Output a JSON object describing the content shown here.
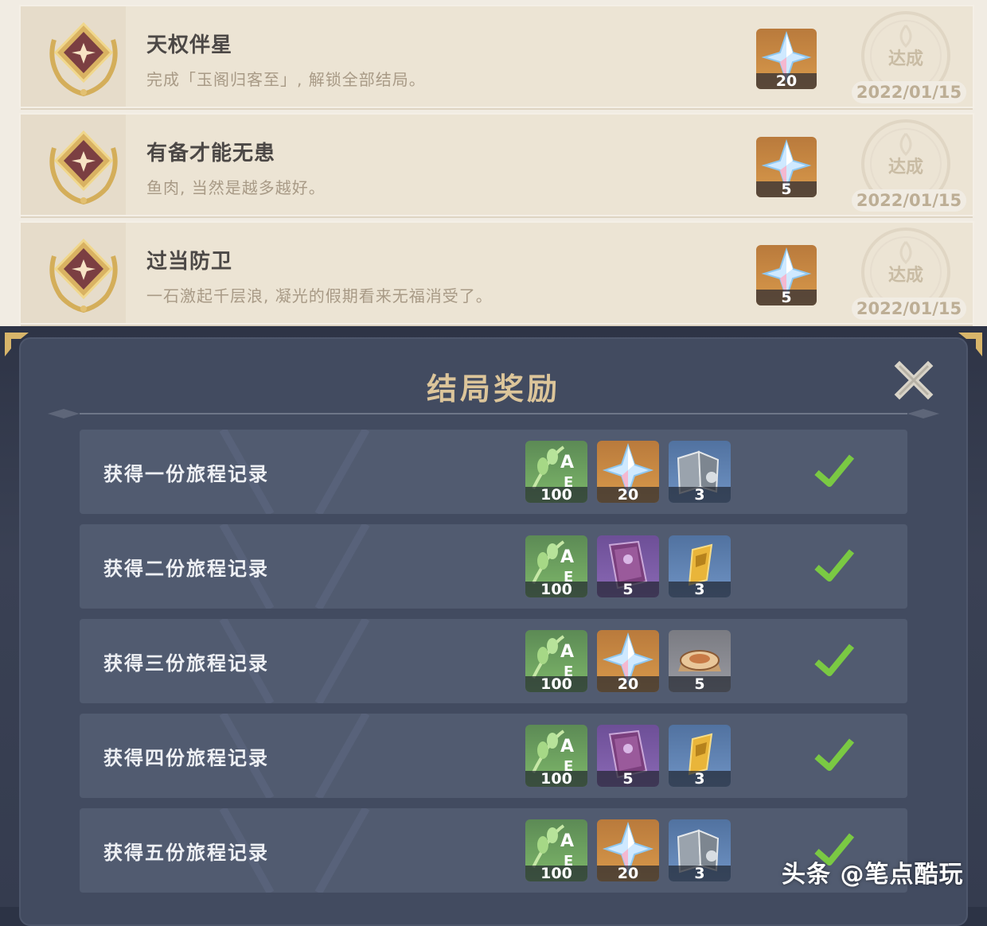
{
  "achievements": [
    {
      "title": "天权伴星",
      "desc": "完成「玉阁归客至」, 解锁全部结局。",
      "reward_count": "20",
      "status": "达成",
      "date": "2022/01/15"
    },
    {
      "title": "有备才能无患",
      "desc": "鱼肉, 当然是越多越好。",
      "reward_count": "5",
      "status": "达成",
      "date": "2022/01/15"
    },
    {
      "title": "过当防卫",
      "desc": "一石激起千层浪, 凝光的假期看来无福消受了。",
      "reward_count": "5",
      "status": "达成",
      "date": "2022/01/15"
    }
  ],
  "panel": {
    "title": "结局奖励",
    "rows": [
      {
        "label": "获得一份旅程记录",
        "items": [
          {
            "icon": "adventure-exp-icon",
            "count": "100"
          },
          {
            "icon": "primogem-icon",
            "count": "20"
          },
          {
            "icon": "talent-book-icon",
            "count": "3"
          }
        ]
      },
      {
        "label": "获得二份旅程记录",
        "items": [
          {
            "icon": "adventure-exp-icon",
            "count": "100"
          },
          {
            "icon": "heros-wit-icon",
            "count": "5"
          },
          {
            "icon": "weapon-ore-icon",
            "count": "3"
          }
        ]
      },
      {
        "label": "获得三份旅程记录",
        "items": [
          {
            "icon": "adventure-exp-icon",
            "count": "100"
          },
          {
            "icon": "primogem-icon",
            "count": "20"
          },
          {
            "icon": "food-dish-icon",
            "count": "5"
          }
        ]
      },
      {
        "label": "获得四份旅程记录",
        "items": [
          {
            "icon": "adventure-exp-icon",
            "count": "100"
          },
          {
            "icon": "heros-wit-icon",
            "count": "5"
          },
          {
            "icon": "weapon-ore-icon",
            "count": "3"
          }
        ]
      },
      {
        "label": "获得五份旅程记录",
        "items": [
          {
            "icon": "adventure-exp-icon",
            "count": "100"
          },
          {
            "icon": "primogem-icon",
            "count": "20"
          },
          {
            "icon": "talent-book-icon",
            "count": "3"
          }
        ]
      }
    ]
  },
  "watermark": "头条 @笔点酷玩",
  "colors": {
    "accent_gold": "#dcc59a",
    "check_green": "#7ac943",
    "panel_bg": "#424b60",
    "row_bg": "#515b70"
  }
}
